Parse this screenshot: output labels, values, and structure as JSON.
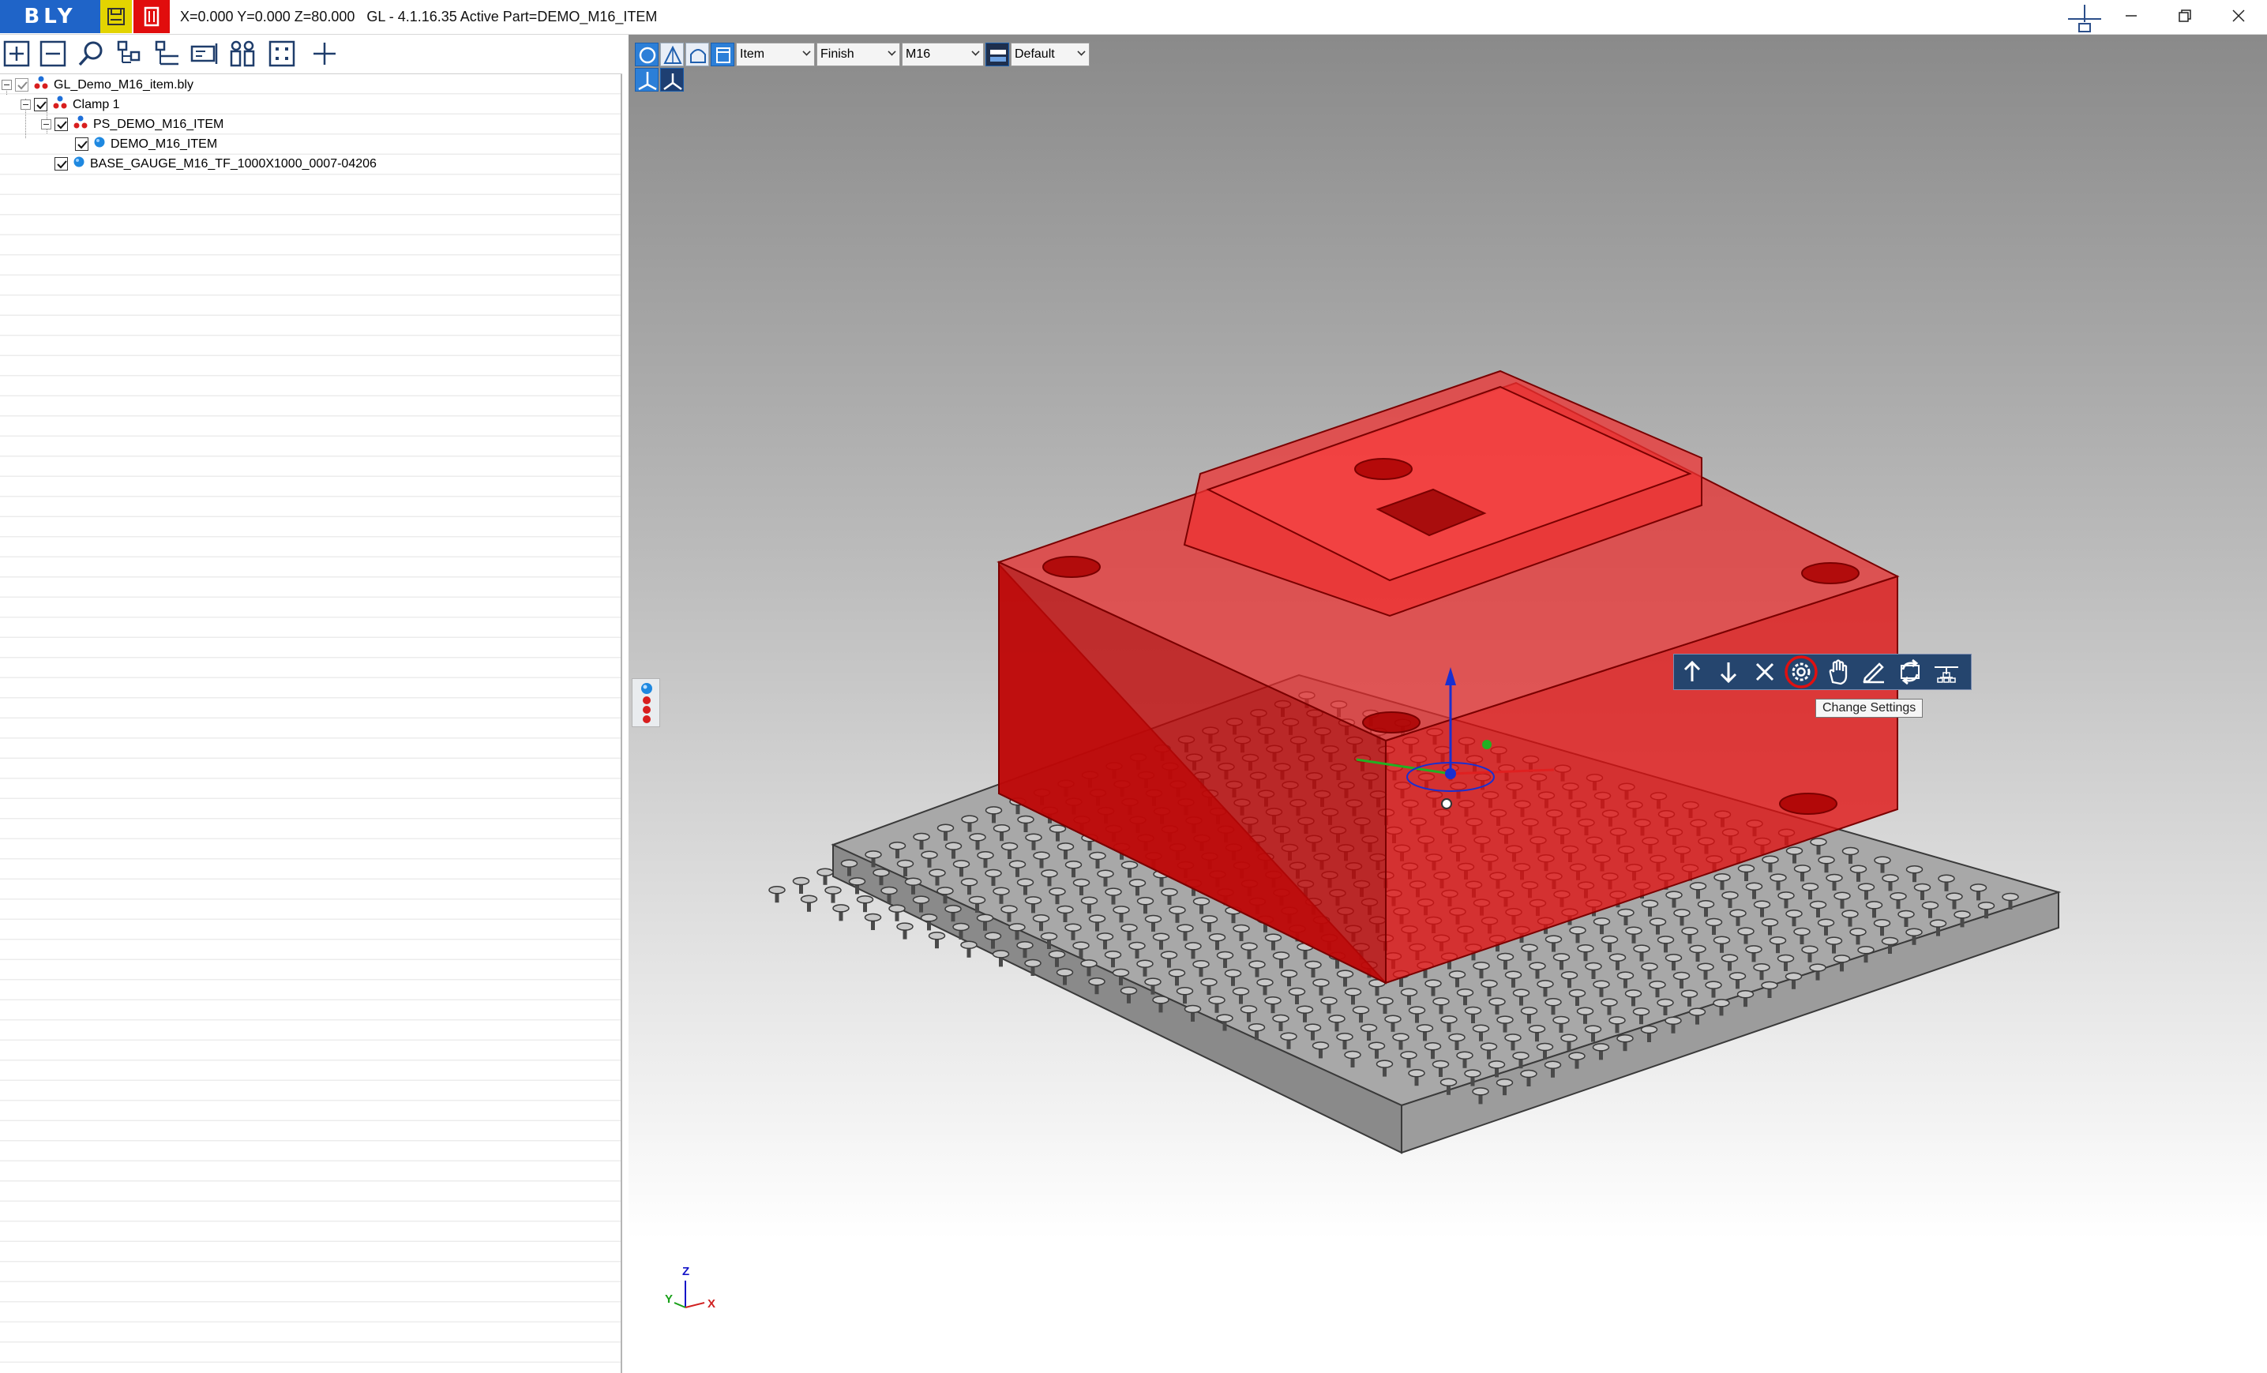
{
  "titlebar": {
    "logo_text": "BLY",
    "status_text": "X=0.000 Y=0.000 Z=80.000   GL - 4.1.16.35 Active Part=DEMO_M16_ITEM"
  },
  "tree": {
    "items": [
      {
        "label": "GL_Demo_M16_item.bly",
        "checked": true
      },
      {
        "label": "Clamp 1",
        "checked": true
      },
      {
        "label": "PS_DEMO_M16_ITEM",
        "checked": true
      },
      {
        "label": "DEMO_M16_ITEM",
        "checked": true
      },
      {
        "label": "BASE_GAUGE_M16_TF_1000X1000_0007-04206",
        "checked": true
      }
    ]
  },
  "viewport": {
    "combos": [
      {
        "value": "Item"
      },
      {
        "value": "Finish"
      },
      {
        "value": "M16"
      },
      {
        "value": "Default"
      }
    ],
    "tooltip": "Change Settings",
    "axes": {
      "x": "X",
      "y": "Y",
      "z": "Z"
    }
  },
  "colors": {
    "logo_bg": "#1f64c8",
    "save_bg": "#e3d400",
    "close_bg": "#e10d0d",
    "part_red": "#e01010",
    "toolbar_blue": "#2c7fd8",
    "part_toolbar_bg": "#25456e"
  },
  "icons": {
    "left_toolbar": [
      "expand-all-icon",
      "collapse-all-icon",
      "search-icon",
      "tree-structure-icon",
      "tree-list-icon",
      "properties-icon",
      "find-pairs-icon",
      "fit-view-icon",
      "add-icon"
    ],
    "part_toolbar": [
      "arrow-up-icon",
      "arrow-down-icon",
      "close-icon",
      "gear-icon",
      "hand-icon",
      "edit-icon",
      "sync-icon",
      "hierarchy-icon"
    ]
  }
}
